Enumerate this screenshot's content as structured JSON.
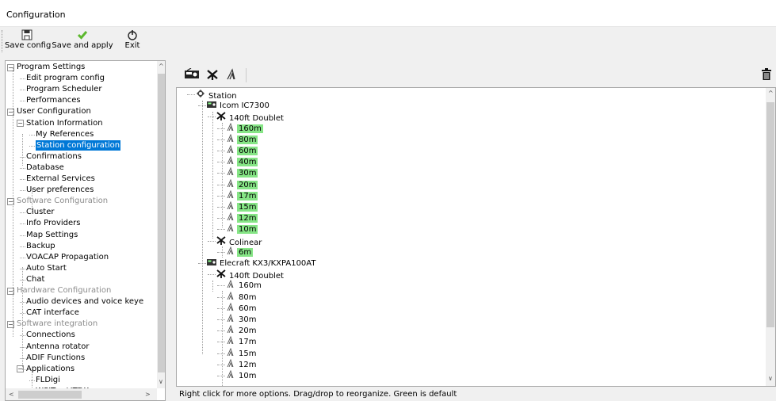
{
  "window": {
    "title": "Configuration"
  },
  "ribbon": {
    "buttons": [
      {
        "label": "Save config",
        "icon": "floppy-icon"
      },
      {
        "label": "Save and apply",
        "icon": "checkmark-icon"
      },
      {
        "label": "Exit",
        "icon": "power-icon"
      }
    ]
  },
  "left_tree": {
    "items": [
      {
        "label": "Program Settings",
        "level": 0,
        "expanded": true
      },
      {
        "label": "Edit program config",
        "level": 1
      },
      {
        "label": "Program Scheduler",
        "level": 1
      },
      {
        "label": "Performances",
        "level": 1
      },
      {
        "label": "User Configuration",
        "level": 0,
        "expanded": true
      },
      {
        "label": "Station Information",
        "level": 1,
        "expanded": true
      },
      {
        "label": "My References",
        "level": 2
      },
      {
        "label": "Station configuration",
        "level": 2,
        "selected": true
      },
      {
        "label": "Confirmations",
        "level": 1
      },
      {
        "label": "Database",
        "level": 1
      },
      {
        "label": "External Services",
        "level": 1
      },
      {
        "label": "User preferences",
        "level": 1
      },
      {
        "label": "Software Configuration",
        "level": 0,
        "expanded": true,
        "gray": true
      },
      {
        "label": "Cluster",
        "level": 1
      },
      {
        "label": "Info Providers",
        "level": 1
      },
      {
        "label": "Map Settings",
        "level": 1
      },
      {
        "label": "Backup",
        "level": 1
      },
      {
        "label": "VOACAP Propagation",
        "level": 1
      },
      {
        "label": "Auto Start",
        "level": 1
      },
      {
        "label": "Chat",
        "level": 1
      },
      {
        "label": "Hardware Configuration",
        "level": 0,
        "expanded": true,
        "gray": true
      },
      {
        "label": "Audio devices and voice keye",
        "level": 1
      },
      {
        "label": "CAT interface",
        "level": 1
      },
      {
        "label": "Software integration",
        "level": 0,
        "expanded": true,
        "gray": true
      },
      {
        "label": "Connections",
        "level": 1
      },
      {
        "label": "Antenna rotator",
        "level": 1
      },
      {
        "label": "ADIF Functions",
        "level": 1
      },
      {
        "label": "Applications",
        "level": 1,
        "expanded": true
      },
      {
        "label": "FLDigi",
        "level": 2
      },
      {
        "label": "WSJT-x / JTDX",
        "level": 2
      }
    ]
  },
  "right_toolbar": {
    "icons": [
      "radio-icon",
      "antenna-icon",
      "band-icon",
      "trash-icon"
    ]
  },
  "station_tree": {
    "root": "Station",
    "items": [
      {
        "label": "Icom IC7300",
        "type": "radio",
        "level": 1
      },
      {
        "label": "140ft Doublet",
        "type": "antenna",
        "level": 2
      },
      {
        "label": "160m",
        "type": "band",
        "level": 3,
        "green": true
      },
      {
        "label": "80m",
        "type": "band",
        "level": 3,
        "green": true
      },
      {
        "label": "60m",
        "type": "band",
        "level": 3,
        "green": true
      },
      {
        "label": "40m",
        "type": "band",
        "level": 3,
        "green": true
      },
      {
        "label": "30m",
        "type": "band",
        "level": 3,
        "green": true
      },
      {
        "label": "20m",
        "type": "band",
        "level": 3,
        "green": true
      },
      {
        "label": "17m",
        "type": "band",
        "level": 3,
        "green": true
      },
      {
        "label": "15m",
        "type": "band",
        "level": 3,
        "green": true
      },
      {
        "label": "12m",
        "type": "band",
        "level": 3,
        "green": true
      },
      {
        "label": "10m",
        "type": "band",
        "level": 3,
        "green": true
      },
      {
        "label": "Colinear",
        "type": "antenna",
        "level": 2
      },
      {
        "label": "6m",
        "type": "band",
        "level": 3,
        "green": true
      },
      {
        "label": "Elecraft KX3/KXPA100AT",
        "type": "radio",
        "level": 1
      },
      {
        "label": "140ft Doublet",
        "type": "antenna",
        "level": 2
      },
      {
        "label": "160m",
        "type": "band",
        "level": 3
      },
      {
        "label": "80m",
        "type": "band",
        "level": 3
      },
      {
        "label": "60m",
        "type": "band",
        "level": 3
      },
      {
        "label": "30m",
        "type": "band",
        "level": 3
      },
      {
        "label": "20m",
        "type": "band",
        "level": 3
      },
      {
        "label": "17m",
        "type": "band",
        "level": 3
      },
      {
        "label": "15m",
        "type": "band",
        "level": 3
      },
      {
        "label": "12m",
        "type": "band",
        "level": 3
      },
      {
        "label": "10m",
        "type": "band",
        "level": 3
      }
    ]
  },
  "status": {
    "text": "Right click for more options. Drag/drop to reorganize. Green is default"
  },
  "colors": {
    "selection": "#0078d7",
    "default_band": "#86e586"
  }
}
